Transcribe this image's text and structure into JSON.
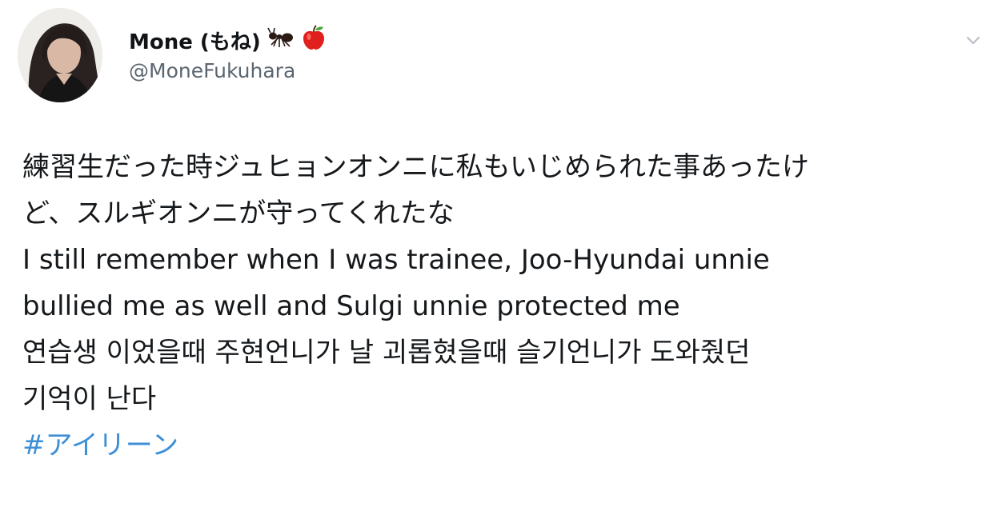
{
  "tweet": {
    "user": {
      "display_name": "Mone (もね)",
      "emoji_names": [
        "ant-emoji",
        "red-apple-emoji"
      ],
      "handle": "@MoneFukuhara"
    },
    "menu_icon": "chevron-down-icon",
    "body_lines": [
      "練習生だった時ジュヒョンオンニに私もいじめられた事あったけ",
      "ど、スルギオンニが守ってくれたな",
      "I still remember when I was trainee, Joo-Hyundai unnie",
      "bullied me as well and Sulgi unnie protected me",
      "연습생 이었을때 주현언니가 날 괴롭혔을때 슬기언니가 도와줬던",
      "기억이 난다"
    ],
    "hashtag": "#アイリーン"
  },
  "colors": {
    "text": "#16191c",
    "secondary": "#5b6670",
    "link": "#3d8fd6",
    "background": "#ffffff"
  }
}
